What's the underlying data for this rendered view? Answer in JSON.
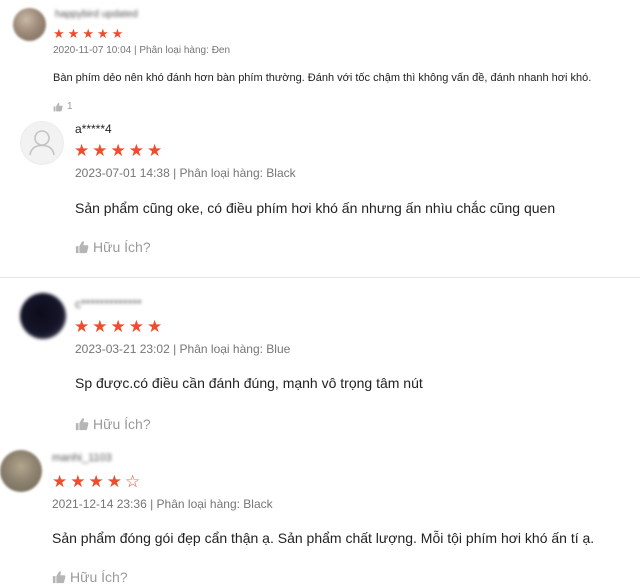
{
  "reviews": [
    {
      "username": "happybird updated",
      "rating": 5,
      "date": "2020-11-07 10:04",
      "variation_label": "Phân loại hàng:",
      "variation": "Đen",
      "content": "Bàn phím dẻo nên khó đánh hơn  bàn phím thường. Đánh với tốc chậm thì không vấn đề, đánh nhanh hơi khó.",
      "helpful_label": "1"
    },
    {
      "username": "a*****4",
      "rating": 5,
      "date": "2023-07-01 14:38",
      "variation_label": "Phân loại hàng:",
      "variation": "Black",
      "content": "Sản phẩm cũng oke, có điều phím hơi khó ấn nhưng ấn nhìu chắc cũng quen",
      "helpful_label": "Hữu Ích?"
    },
    {
      "username": "c*************",
      "rating": 5,
      "date": "2023-03-21 23:02",
      "variation_label": "Phân loại hàng:",
      "variation": "Blue",
      "content": "Sp được.có điều cần đánh đúng, mạnh vô trọng tâm nút",
      "helpful_label": "Hữu Ích?"
    },
    {
      "username": "manhi_1103",
      "rating": 4,
      "date": "2021-12-14 23:36",
      "variation_label": "Phân loại hàng:",
      "variation": "Black",
      "content": "Sản phẩm đóng gói đẹp cẩn thận ạ. Sản phẩm chất lượng. Mỗi tội phím hơi khó ấn tí ạ.",
      "helpful_label": "Hữu Ích?"
    }
  ],
  "icons": {
    "star": "★",
    "star_empty": "☆",
    "thumb": "thumbs-up-icon",
    "default_avatar": "user-silhouette-icon"
  },
  "colors": {
    "star": "#ee4d2d",
    "meta": "#757575",
    "helpful": "#9a9a9a"
  }
}
